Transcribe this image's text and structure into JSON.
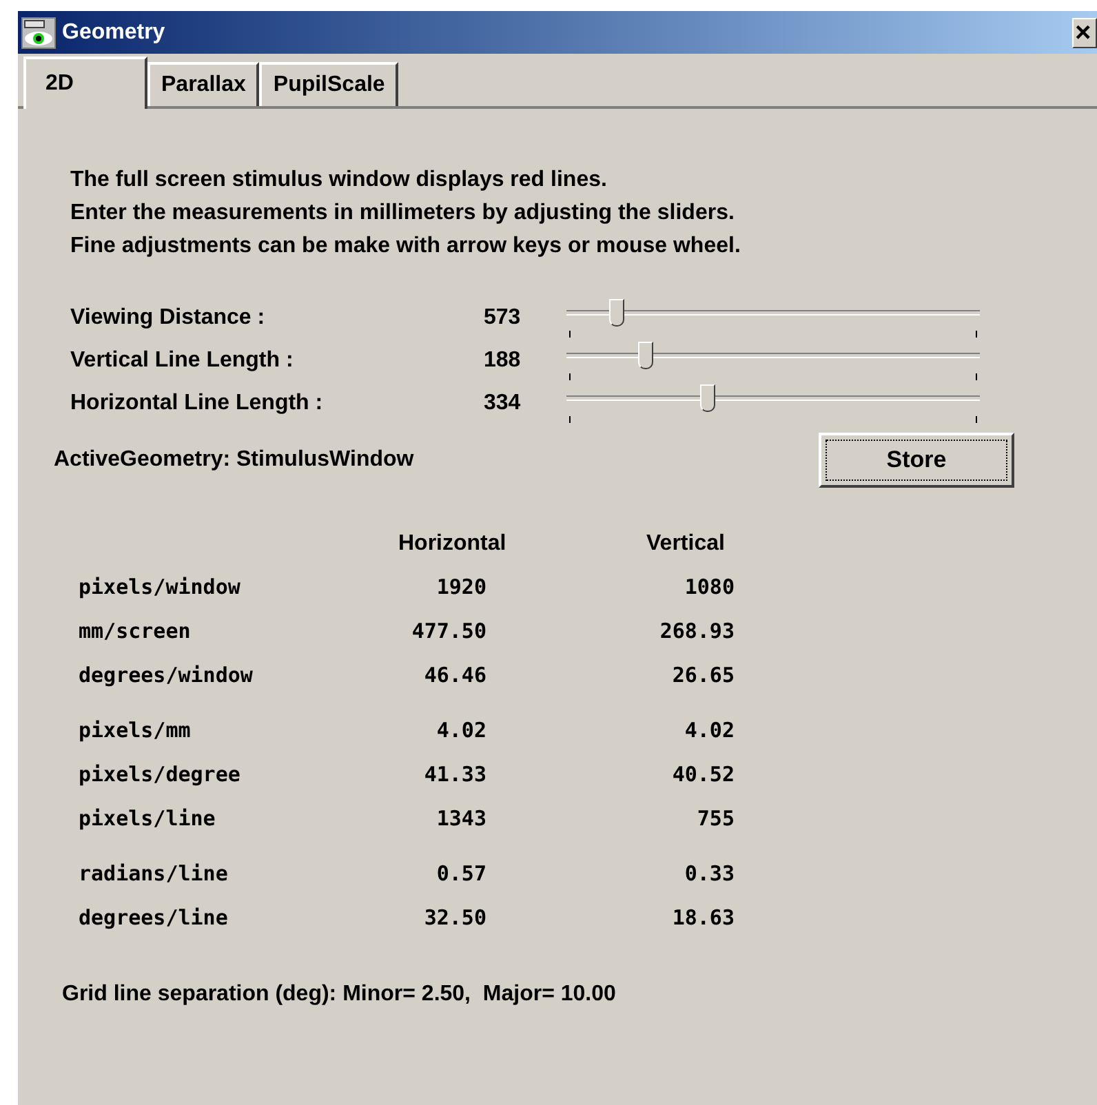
{
  "window": {
    "title": "Geometry",
    "close": "×"
  },
  "tabs": [
    {
      "label": "2D",
      "selected": true
    },
    {
      "label": "Parallax",
      "selected": false
    },
    {
      "label": "PupilScale",
      "selected": false
    }
  ],
  "instructions": [
    "The full screen stimulus window displays red lines.",
    "Enter the measurements in millimeters by adjusting the sliders.",
    "Fine adjustments can be make with arrow keys or mouse wheel."
  ],
  "sliders": [
    {
      "label": "Viewing Distance :",
      "reading": "573",
      "level": 0.12
    },
    {
      "label": "Vertical Line Length :",
      "reading": "188",
      "level": 0.19
    },
    {
      "label": "Horizontal Line Length :",
      "reading": "334",
      "level": 0.34
    }
  ],
  "active_geometry": "ActiveGeometry: StimulusWindow",
  "store_button": "Store",
  "table": {
    "columns": [
      "Horizontal",
      "Vertical"
    ],
    "groups": [
      [
        {
          "label": "pixels/window",
          "horizontal": "1920",
          "vertical": "1080"
        },
        {
          "label": "mm/screen",
          "horizontal": "477.50",
          "vertical": "268.93"
        },
        {
          "label": "degrees/window",
          "horizontal": "46.46",
          "vertical": "26.65"
        }
      ],
      [
        {
          "label": "pixels/mm",
          "horizontal": "4.02",
          "vertical": "4.02"
        },
        {
          "label": "pixels/degree",
          "horizontal": "41.33",
          "vertical": "40.52"
        },
        {
          "label": "pixels/line",
          "horizontal": "1343",
          "vertical": "755"
        }
      ],
      [
        {
          "label": "radians/line",
          "horizontal": "0.57",
          "vertical": "0.33"
        },
        {
          "label": "degrees/line",
          "horizontal": "32.50",
          "vertical": "18.63"
        }
      ]
    ]
  },
  "grid_note": "Grid line separation (deg): Minor= 2.50,  Major= 10.00"
}
